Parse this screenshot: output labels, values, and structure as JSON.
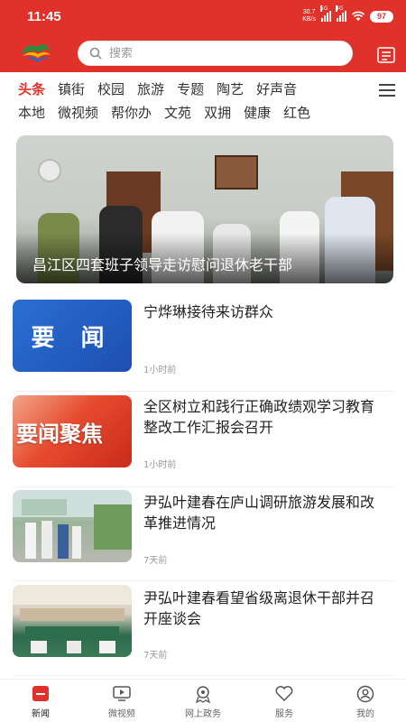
{
  "status_bar": {
    "time": "11:45",
    "net_speed_value": "30.7",
    "net_speed_unit": "KB/s",
    "network_1": "5G",
    "network_2": "4G",
    "battery": "97"
  },
  "colors": {
    "brand_red": "#e0322b",
    "text_dark": "#222222",
    "text_muted": "#999999"
  },
  "header": {
    "logo": "app-logo",
    "search_placeholder": "搜索",
    "message_icon": "message-box-icon"
  },
  "tabs": {
    "row1": [
      "头条",
      "镇街",
      "校园",
      "旅游",
      "专题",
      "陶艺",
      "好声音"
    ],
    "row2": [
      "本地",
      "微视频",
      "帮你办",
      "文苑",
      "双拥",
      "健康",
      "红色"
    ],
    "active": "头条"
  },
  "hero": {
    "caption": "昌江区四套班子领导走访慰问退休老干部"
  },
  "news": [
    {
      "title": "宁烨琳接待来访群众",
      "time": "1小时前",
      "thumb_text": "要 闻"
    },
    {
      "title": "全区树立和践行正确政绩观学习教育整改工作汇报会召开",
      "time": "1小时前",
      "thumb_text": "要闻聚焦"
    },
    {
      "title": "尹弘叶建春在庐山调研旅游发展和改革推进情况",
      "time": "7天前",
      "thumb_text": ""
    },
    {
      "title": "尹弘叶建春看望省级离退休干部并召开座谈会",
      "time": "7天前",
      "thumb_text": ""
    }
  ],
  "bottom_nav": [
    {
      "label": "新闻",
      "icon": "news-icon",
      "active": true
    },
    {
      "label": "微视频",
      "icon": "video-icon",
      "active": false
    },
    {
      "label": "网上政务",
      "icon": "government-icon",
      "active": false
    },
    {
      "label": "服务",
      "icon": "heart-service-icon",
      "active": false
    },
    {
      "label": "我的",
      "icon": "user-icon",
      "active": false
    }
  ]
}
